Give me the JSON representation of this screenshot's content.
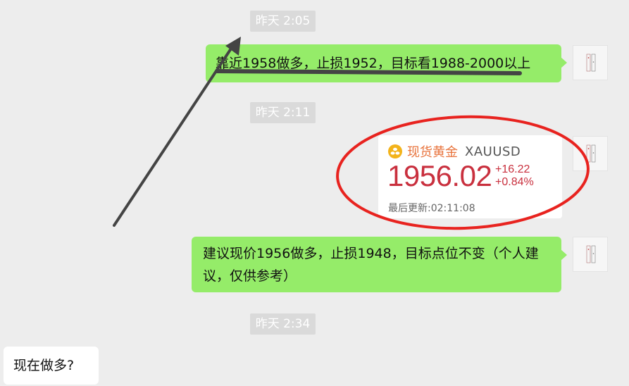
{
  "messages": {
    "time1": "昨天 2:05",
    "msg1": "靠近1958做多，止损1952，目标看1988-2000以上",
    "time2": "昨天 2:11",
    "time3": "昨天 2:34",
    "msg2": "建议现价1956做多，止损1948，目标点位不变（个人建议，仅供参考）",
    "msg3": "现在做多?"
  },
  "quote_card": {
    "icon": "gold-coins-icon",
    "name": "现货黄金",
    "code": "XAUUSD",
    "price": "1956.02",
    "change": "+16.22",
    "change_pct": "+0.84%",
    "updated_label": "最后更新:",
    "updated_time": "02:11:08",
    "price_color": "#c9303e",
    "name_color": "#e8733c"
  },
  "annotations": {
    "circle_color": "#e8231f",
    "arrow_color": "#444444",
    "underline_color": "#444444"
  },
  "colors": {
    "background": "#ededed",
    "sent_bubble": "#95ec69",
    "received_bubble": "#ffffff",
    "timestamp_bg": "#dadada"
  }
}
